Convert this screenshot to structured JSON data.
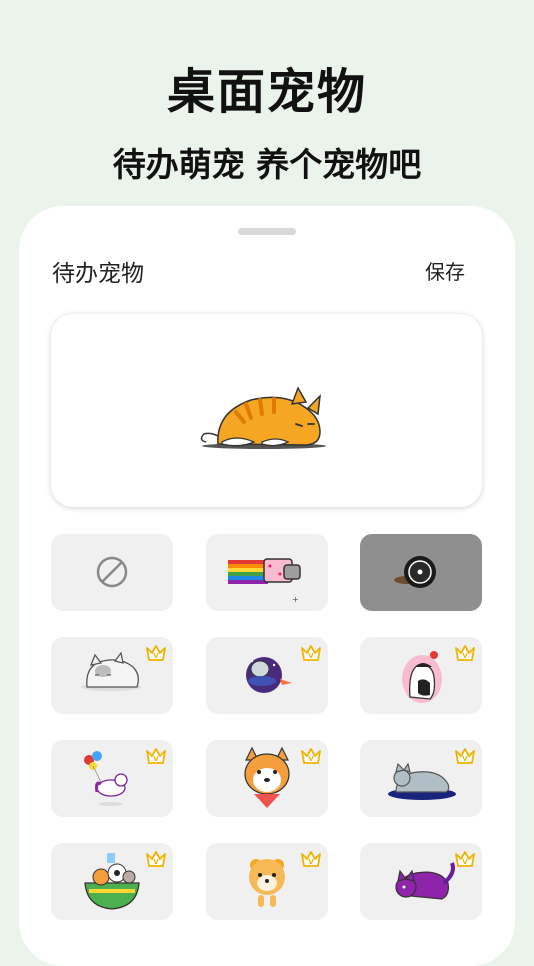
{
  "header": {
    "title": "桌面宠物",
    "subtitle": "待办萌宠 养个宠物吧"
  },
  "sheet": {
    "title": "待办宠物",
    "save_label": "保存"
  },
  "pets": [
    {
      "name": "none",
      "premium": false,
      "selected": false
    },
    {
      "name": "nyan-cat",
      "premium": false,
      "selected": false
    },
    {
      "name": "vinyl-record",
      "premium": false,
      "selected": true
    },
    {
      "name": "sleepy-cat",
      "premium": true,
      "selected": false
    },
    {
      "name": "space-cat",
      "premium": true,
      "selected": false
    },
    {
      "name": "sitting-cat",
      "premium": true,
      "selected": false
    },
    {
      "name": "unicorn-balloons",
      "premium": true,
      "selected": false
    },
    {
      "name": "shiba-dog",
      "premium": true,
      "selected": false
    },
    {
      "name": "lying-gray-cat",
      "premium": true,
      "selected": false
    },
    {
      "name": "animals-bowl",
      "premium": true,
      "selected": false
    },
    {
      "name": "pomeranian-dog",
      "premium": true,
      "selected": false
    },
    {
      "name": "purple-cat",
      "premium": true,
      "selected": false
    }
  ],
  "colors": {
    "background": "#eaf4ea",
    "crown": "#f0b400",
    "selected_tile": "#8f8f8f"
  }
}
